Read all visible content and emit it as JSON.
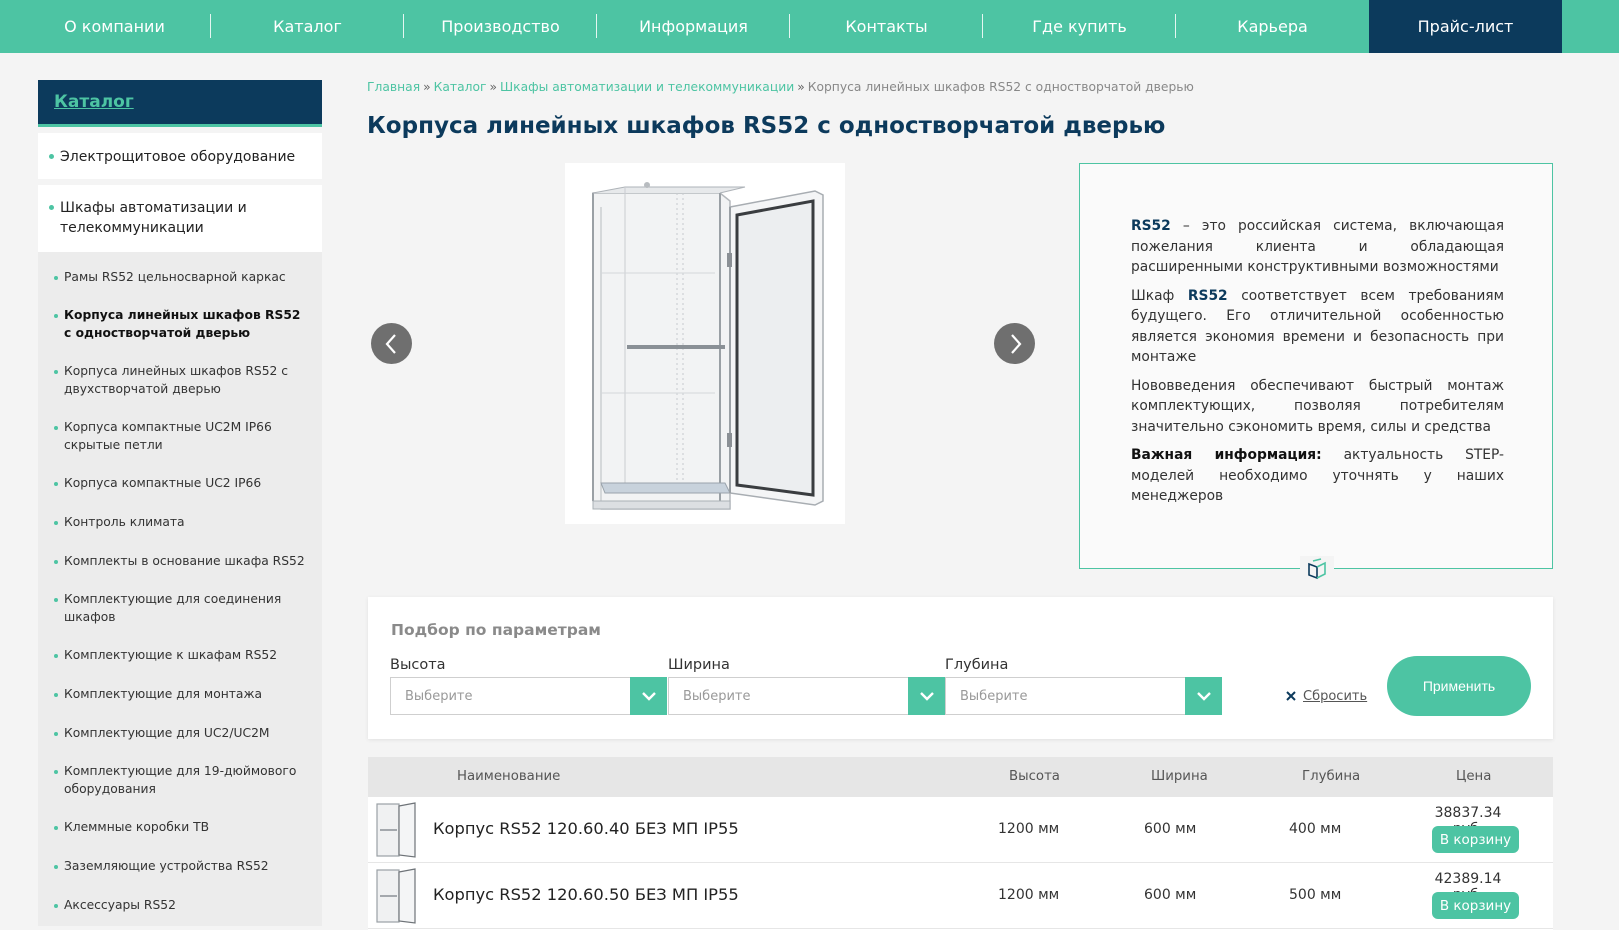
{
  "nav": {
    "items": [
      "О компании",
      "Каталог",
      "Производство",
      "Информация",
      "Контакты",
      "Где купить",
      "Карьера"
    ],
    "price_list": "Прайс-лист"
  },
  "sidebar": {
    "title": "Каталог",
    "main_items": [
      "Электрощитовое оборудование",
      "Шкафы автоматизации и телекоммуникации"
    ],
    "sub_items": [
      "Рамы RS52 цельносварной каркас",
      "Корпуса линейных шкафов RS52 с одностворчатой дверью",
      "Корпуса линейных шкафов RS52 с двухстворчатой дверью",
      "Корпуса компактные UC2M IP66 скрытые петли",
      "Корпуса компактные UC2 IP66",
      "Контроль климата",
      "Комплекты в основание шкафа RS52",
      "Комплектующие для соединения шкафов",
      "Комплектующие к шкафам RS52",
      "Комплектующие для монтажа",
      "Комплектующие для UC2/UC2M",
      "Комплектующие для 19-дюймового оборудования",
      "Клеммные коробки ТВ",
      "Заземляющие устройства RS52",
      "Аксессуары RS52"
    ]
  },
  "breadcrumb": {
    "items": [
      "Главная",
      "Каталог",
      "Шкафы автоматизации и телекоммуникации"
    ],
    "current": "Корпуса линейных шкафов RS52 с одностворчатой дверью",
    "separator": "»"
  },
  "page": {
    "title": "Корпуса линейных шкафов RS52 с одностворчатой дверью"
  },
  "info": {
    "p1_bold": "RS52",
    "p1_text": " – это российская система, включающая пожелания клиента и обладающая расширенными конструктивными возможностями",
    "p2_pre": "Шкаф ",
    "p2_bold": "RS52",
    "p2_text": " соответствует всем требованиям будущего. Его отличительной особенностью является экономия времени и безопасность при монтаже",
    "p3_text": "Нововведения обеспечивают быстрый монтаж комплектующих, позволяя потребителям значительно сэкономить время, силы и средства",
    "p4_bold": "Важная информация:",
    "p4_text": " актуальность STEP-моделей необходимо уточнять у наших менеджеров"
  },
  "filter": {
    "title": "Подбор по параметрам",
    "fields": [
      {
        "label": "Высота",
        "placeholder": "Выберите"
      },
      {
        "label": "Ширина",
        "placeholder": "Выберите"
      },
      {
        "label": "Глубина",
        "placeholder": "Выберите"
      }
    ],
    "reset": "Сбросить",
    "apply": "Применить"
  },
  "table": {
    "headers": [
      "Наименование",
      "Высота",
      "Ширина",
      "Глубина",
      "Цена"
    ],
    "rows": [
      {
        "name": "Корпус RS52 120.60.40 БЕЗ МП IP55",
        "height": "1200 мм",
        "width": "600 мм",
        "depth": "400 мм",
        "price": "38837.34 руб.",
        "cart": "В корзину"
      },
      {
        "name": "Корпус RS52 120.60.50 БЕЗ МП IP55",
        "height": "1200 мм",
        "width": "600 мм",
        "depth": "500 мм",
        "price": "42389.14 руб.",
        "cart": "В корзину"
      }
    ]
  },
  "colors": {
    "accent": "#4dc4a3",
    "navy": "#0c3a5c",
    "page_bg": "#f4f4f4"
  },
  "icons": [
    "chevron-left-icon",
    "chevron-right-icon",
    "chevron-down-icon",
    "close-icon",
    "book-icon"
  ]
}
